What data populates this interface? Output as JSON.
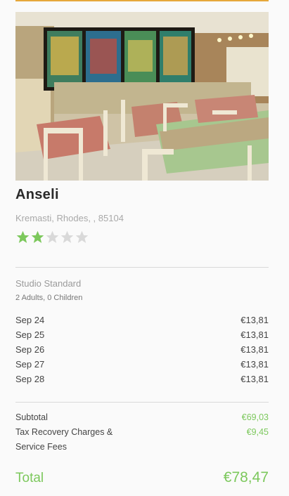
{
  "hotel": {
    "name": "Anseli",
    "address": "Kremasti, Rhodes, , 85104",
    "rating": 2,
    "max_rating": 5
  },
  "booking": {
    "room_type": "Studio Standard",
    "guests": "2 Adults, 0 Children",
    "nights": [
      {
        "date": "Sep 24",
        "price": "€13,81"
      },
      {
        "date": "Sep 25",
        "price": "€13,81"
      },
      {
        "date": "Sep 26",
        "price": "€13,81"
      },
      {
        "date": "Sep 27",
        "price": "€13,81"
      },
      {
        "date": "Sep 28",
        "price": "€13,81"
      }
    ]
  },
  "summary": {
    "subtotal_label": "Subtotal",
    "subtotal_value": "€69,03",
    "tax_label": "Tax Recovery Charges & Service Fees",
    "tax_value": "€9,45",
    "total_label": "Total",
    "total_value": "€78,47"
  },
  "colors": {
    "accent_green": "#7cc85c",
    "top_accent": "#e6a73a",
    "star_empty": "#d9d9d9"
  }
}
